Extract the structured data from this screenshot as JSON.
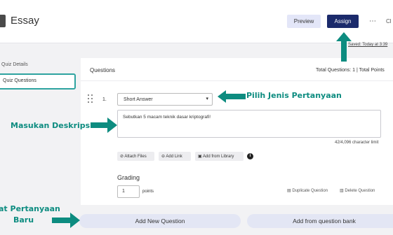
{
  "header": {
    "title": "Essay",
    "preview_label": "Preview",
    "assign_label": "Assign",
    "more_icon": "⋯",
    "close_label": "Cl",
    "saved_text": "Saved: Today at 3:39"
  },
  "sidebar": {
    "items": [
      {
        "label": "Quiz Details"
      },
      {
        "label": "Quiz Questions"
      }
    ]
  },
  "questions": {
    "heading": "Questions",
    "totals": "Total Questions: 1  |  Total Points",
    "number": "1.",
    "type_selected": "Short Answer",
    "description": "Sebutkan 5 macam teknik dasar kriptografi!",
    "char_limit": "42/4,096 character limit",
    "attach_files": "Attach Files",
    "add_link": "Add Link",
    "add_from_library": "Add from Library",
    "info_icon": "i",
    "grading_label": "Grading",
    "points_value": "1",
    "points_label": "points",
    "duplicate_label": "Duplicate Question",
    "delete_label": "Delete Question"
  },
  "footer": {
    "add_new": "Add New Question",
    "add_bank": "Add from question bank"
  },
  "annotations": {
    "jenis": "Pilih Jenis Pertanyaan",
    "deskripsi": "Masukan Deskripsi",
    "baru_line1": "at Pertanyaan",
    "baru_line2": "Baru"
  },
  "colors": {
    "accent": "#0d8c80",
    "assign_button": "#1b2a6b",
    "sidebar_selected_border": "#2ea3a0"
  }
}
